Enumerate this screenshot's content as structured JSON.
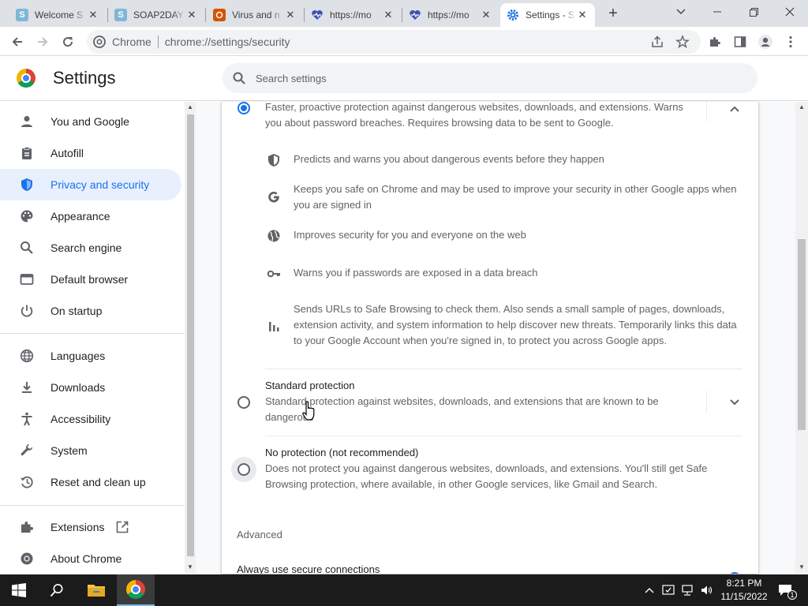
{
  "browser": {
    "tabs": [
      {
        "title": "Welcome S",
        "favicon": "S",
        "favicon_color": "#7fb7d6"
      },
      {
        "title": "SOAP2DAY",
        "favicon": "S",
        "favicon_color": "#7fb7d6"
      },
      {
        "title": "Virus and n",
        "favicon": "virus-icon",
        "favicon_color": "#d35400"
      },
      {
        "title": "https://mo",
        "favicon": "heart-pulse-icon",
        "favicon_color": "#3f51b5"
      },
      {
        "title": "https://mo",
        "favicon": "heart-pulse-icon",
        "favicon_color": "#3f51b5"
      },
      {
        "title": "Settings - S",
        "favicon": "gear-icon",
        "favicon_color": "#1a73e8"
      }
    ],
    "omnibox": {
      "site": "Chrome",
      "url": "chrome://settings/security"
    }
  },
  "settings": {
    "title": "Settings",
    "search_placeholder": "Search settings"
  },
  "sidebar": {
    "items": [
      {
        "label": "You and Google",
        "icon": "person-icon"
      },
      {
        "label": "Autofill",
        "icon": "clipboard-icon"
      },
      {
        "label": "Privacy and security",
        "icon": "shield-icon",
        "selected": true
      },
      {
        "label": "Appearance",
        "icon": "palette-icon"
      },
      {
        "label": "Search engine",
        "icon": "search-icon"
      },
      {
        "label": "Default browser",
        "icon": "browser-icon"
      },
      {
        "label": "On startup",
        "icon": "power-icon"
      },
      {
        "label": "Languages",
        "icon": "globe-icon"
      },
      {
        "label": "Downloads",
        "icon": "download-icon"
      },
      {
        "label": "Accessibility",
        "icon": "accessibility-icon"
      },
      {
        "label": "System",
        "icon": "wrench-icon"
      },
      {
        "label": "Reset and clean up",
        "icon": "history-icon"
      },
      {
        "label": "Extensions",
        "icon": "puzzle-icon"
      },
      {
        "label": "About Chrome",
        "icon": "chrome-icon"
      }
    ]
  },
  "main": {
    "enhanced": {
      "description": "Faster, proactive protection against dangerous websites, downloads, and extensions. Warns you about password breaches. Requires browsing data to be sent to Google.",
      "features": [
        {
          "icon": "shield-icon",
          "text": "Predicts and warns you about dangerous events before they happen"
        },
        {
          "icon": "google-g-icon",
          "text": "Keeps you safe on Chrome and may be used to improve your security in other Google apps when you are signed in"
        },
        {
          "icon": "globe-icon",
          "text": "Improves security for you and everyone on the web"
        },
        {
          "icon": "key-icon",
          "text": "Warns you if passwords are exposed in a data breach"
        },
        {
          "icon": "bar-chart-icon",
          "text": "Sends URLs to Safe Browsing to check them. Also sends a small sample of pages, downloads, extension activity, and system information to help discover new threats. Temporarily links this data to your Google Account when you're signed in, to protect you across Google apps."
        }
      ]
    },
    "standard": {
      "label": "Standard protection",
      "description": "Standard protection against websites, downloads, and extensions that are known to be dangerous"
    },
    "none": {
      "label": "No protection (not recommended)",
      "description": "Does not protect you against dangerous websites, downloads, and extensions. You'll still get Safe Browsing protection, where available, in other Google services, like Gmail and Search."
    },
    "advanced_title": "Advanced",
    "secure_connections": "Always use secure connections"
  },
  "taskbar": {
    "time": "8:21 PM",
    "date": "11/15/2022",
    "notification_count": "1"
  }
}
